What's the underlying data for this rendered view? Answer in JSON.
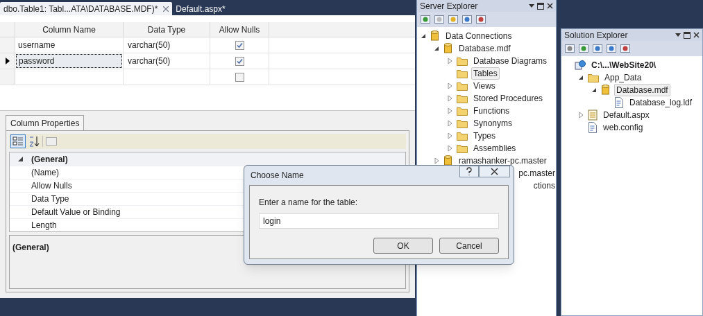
{
  "document_tabs": [
    {
      "label": "dbo.Table1: Tabl...ATA\\DATABASE.MDF)*",
      "selected": true
    },
    {
      "label": "Default.aspx*",
      "selected": false
    }
  ],
  "table_designer": {
    "columns": [
      "Column Name",
      "Data Type",
      "Allow Nulls"
    ],
    "rows": [
      {
        "name": "username",
        "type": "varchar(50)",
        "allow_nulls": true,
        "selected": false
      },
      {
        "name": "password",
        "type": "varchar(50)",
        "allow_nulls": true,
        "selected": true
      },
      {
        "allow_nulls": false,
        "selected": false
      }
    ]
  },
  "column_properties": {
    "tab": "Column Properties",
    "category": "(General)",
    "properties": [
      "(Name)",
      "Allow Nulls",
      "Data Type",
      "Default Value or Binding",
      "Length"
    ],
    "description_title": "(General)"
  },
  "server_explorer": {
    "title": "Server Explorer",
    "tree": [
      {
        "label": "Data Connections",
        "kind": "db",
        "expanded": true,
        "children": [
          {
            "label": "Database.mdf",
            "kind": "db",
            "expanded": true,
            "children": [
              {
                "label": "Database Diagrams",
                "kind": "folder",
                "expanded": false
              },
              {
                "label": "Tables",
                "kind": "folder",
                "selected": true
              },
              {
                "label": "Views",
                "kind": "folder",
                "expanded": false
              },
              {
                "label": "Stored Procedures",
                "kind": "folder",
                "expanded": false
              },
              {
                "label": "Functions",
                "kind": "folder",
                "expanded": false
              },
              {
                "label": "Synonyms",
                "kind": "folder",
                "expanded": false
              },
              {
                "label": "Types",
                "kind": "folder",
                "expanded": false
              },
              {
                "label": "Assemblies",
                "kind": "folder",
                "expanded": false
              }
            ]
          },
          {
            "label": "ramashanker-pc.master",
            "kind": "db",
            "expanded": false
          },
          {
            "label": "pc.master",
            "kind": "partial"
          },
          {
            "label": "ctions",
            "kind": "partial"
          }
        ]
      }
    ]
  },
  "solution_explorer": {
    "title": "Solution Explorer",
    "tree": [
      {
        "label": "C:\\...\\WebSite20\\",
        "kind": "web",
        "bold": true,
        "children": [
          {
            "label": "App_Data",
            "kind": "folder",
            "expanded": true,
            "children": [
              {
                "label": "Database.mdf",
                "kind": "db",
                "expanded": true,
                "selected": true,
                "children": [
                  {
                    "label": "Database_log.ldf",
                    "kind": "file"
                  }
                ]
              }
            ]
          },
          {
            "label": "Default.aspx",
            "kind": "page",
            "expanded": false
          },
          {
            "label": "web.config",
            "kind": "file"
          }
        ]
      }
    ]
  },
  "dialog": {
    "title": "Choose Name",
    "prompt": "Enter a name for the table:",
    "value": "login",
    "buttons": [
      "OK",
      "Cancel"
    ]
  }
}
